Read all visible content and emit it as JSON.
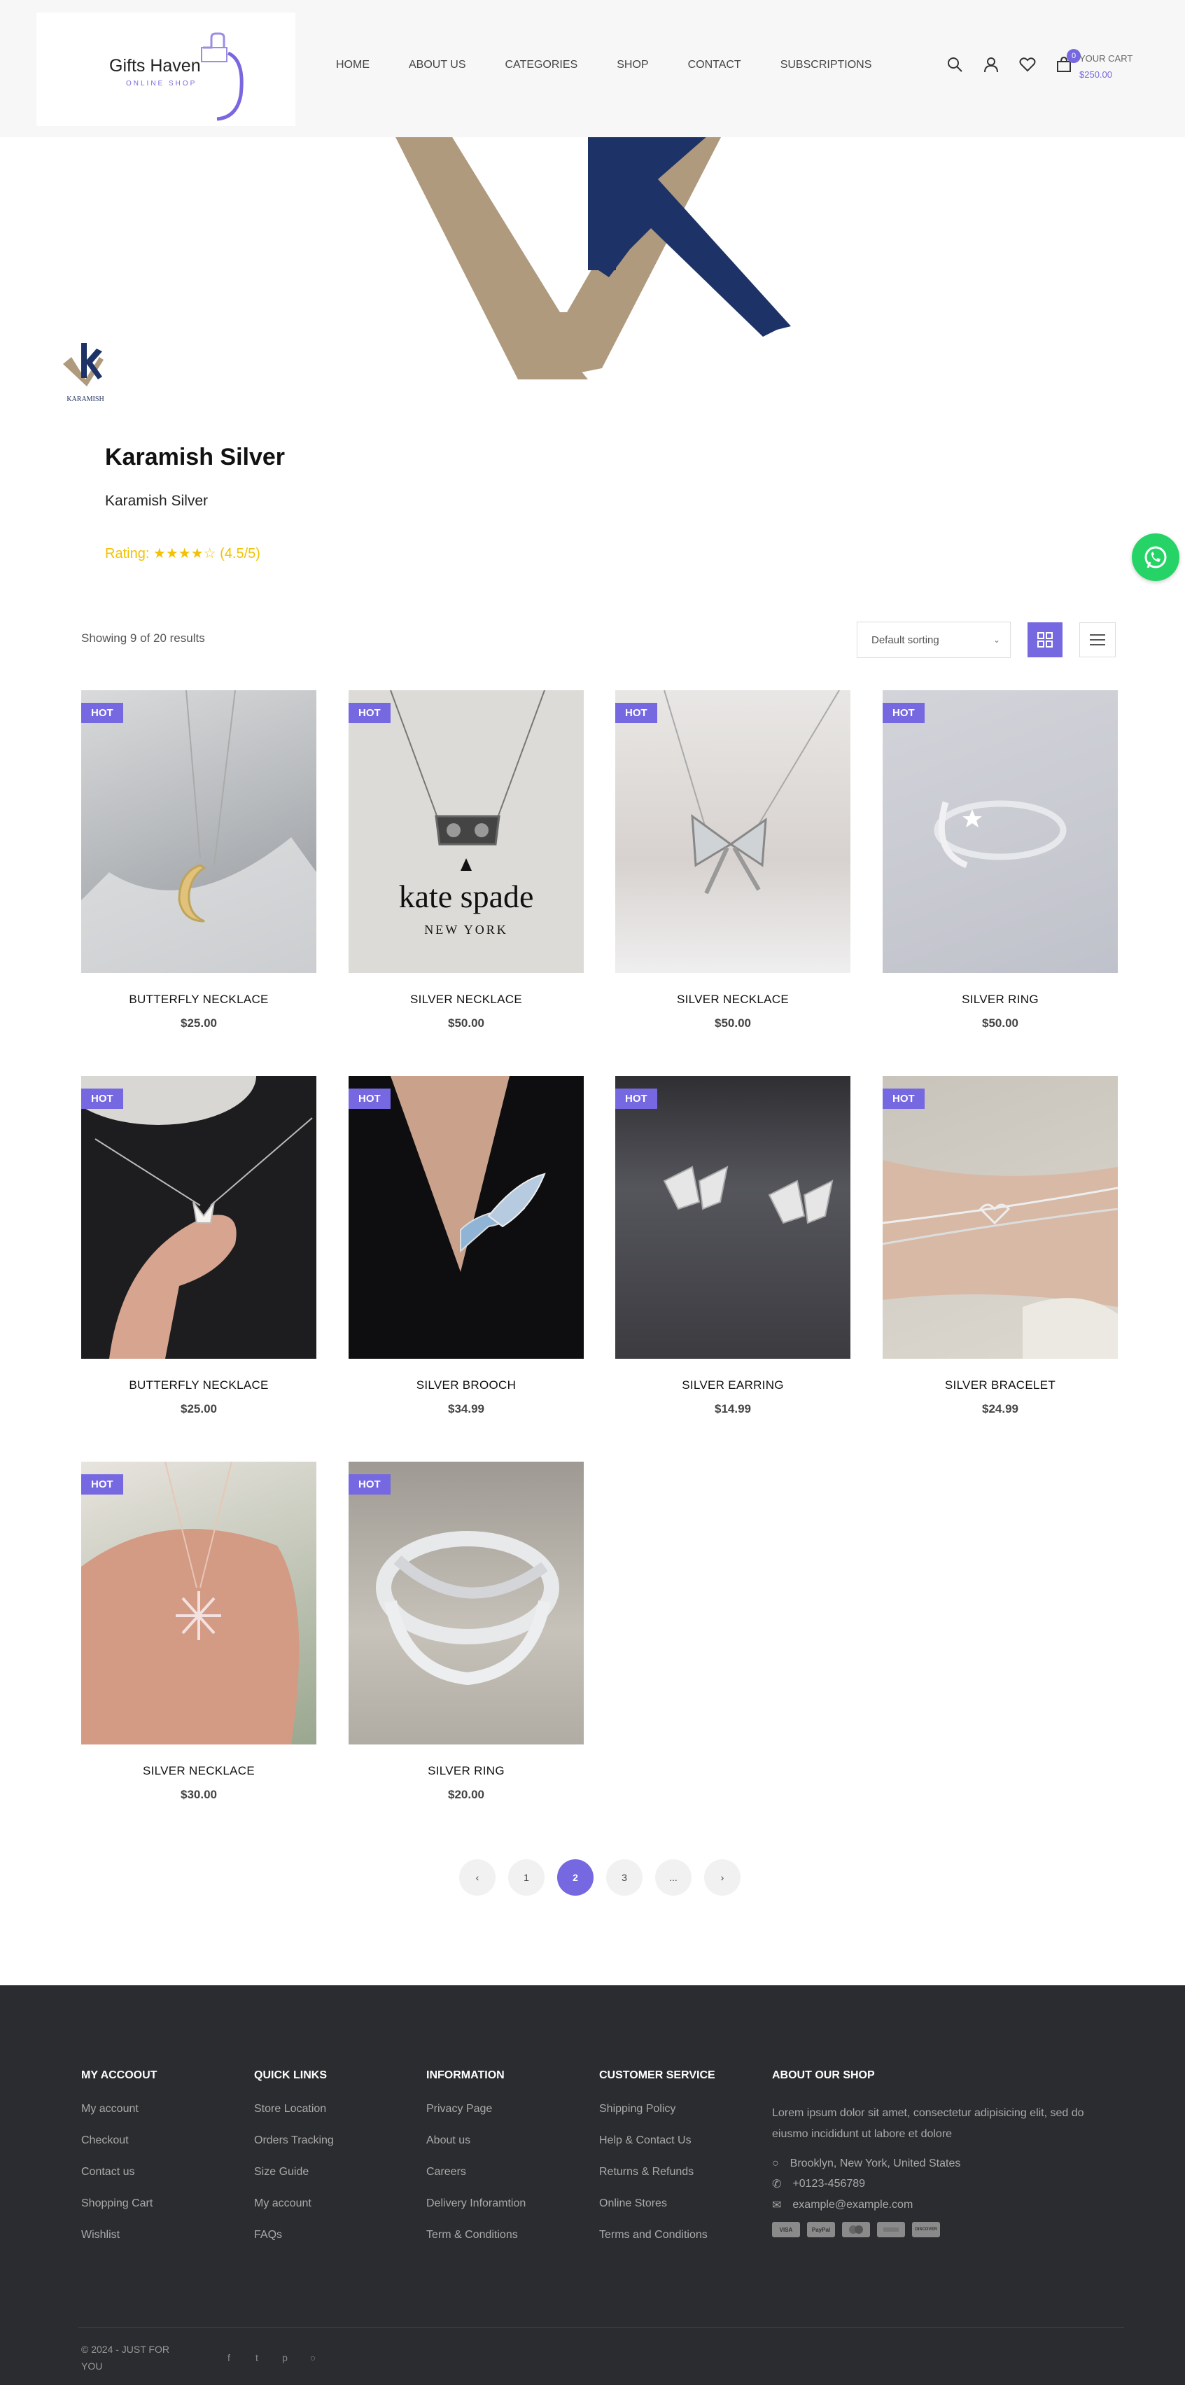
{
  "header": {
    "logo_title": "Gifts Haven",
    "logo_subtitle": "ONLINE SHOP",
    "nav": [
      "HOME",
      "ABOUT US",
      "CATEGORIES",
      "SHOP",
      "CONTACT",
      "SUBSCRIPTIONS"
    ],
    "cart_count": "0",
    "cart_label": "YOUR CART",
    "cart_total": "$250.00"
  },
  "brand": {
    "logo_text": "KARAMISH",
    "name": "Karamish Silver",
    "subtitle": "Karamish Silver",
    "rating": "Rating: ★★★★☆ (4.5/5)"
  },
  "toolbar": {
    "results": "Showing 9 of 20 results",
    "sort": "Default sorting"
  },
  "products": [
    {
      "badge": "HOT",
      "name": "BUTTERFLY NECKLACE",
      "price": "$25.00"
    },
    {
      "badge": "HOT",
      "name": "SILVER NECKLACE",
      "price": "$50.00",
      "image_text": "kate spade",
      "image_subtext": "NEW YORK"
    },
    {
      "badge": "HOT",
      "name": "SILVER NECKLACE",
      "price": "$50.00"
    },
    {
      "badge": "HOT",
      "name": "SILVER RING",
      "price": "$50.00"
    },
    {
      "badge": "HOT",
      "name": "BUTTERFLY NECKLACE",
      "price": "$25.00"
    },
    {
      "badge": "HOT",
      "name": "SILVER BROOCH",
      "price": "$34.99"
    },
    {
      "badge": "HOT",
      "name": "SILVER EARRING",
      "price": "$14.99"
    },
    {
      "badge": "HOT",
      "name": "SILVER BRACELET",
      "price": "$24.99"
    },
    {
      "badge": "HOT",
      "name": "SILVER NECKLACE",
      "price": "$30.00"
    },
    {
      "badge": "HOT",
      "name": "SILVER RING",
      "price": "$20.00"
    }
  ],
  "pagination": {
    "pages": [
      "1",
      "2",
      "3",
      "..."
    ],
    "active": "2"
  },
  "footer": {
    "account": {
      "title": "MY ACCOOUT",
      "links": [
        "My account",
        "Checkout",
        "Contact us",
        "Shopping Cart",
        "Wishlist"
      ]
    },
    "quick": {
      "title": "QUICK LINKS",
      "links": [
        "Store Location",
        "Orders Tracking",
        "Size Guide",
        "My account",
        "FAQs"
      ]
    },
    "info": {
      "title": "INFORMATION",
      "links": [
        "Privacy Page",
        "About us",
        "Careers",
        "Delivery Inforamtion",
        "Term & Conditions"
      ]
    },
    "service": {
      "title": "CUSTOMER SERVICE",
      "links": [
        "Shipping Policy",
        "Help & Contact Us",
        "Returns & Refunds",
        "Online Stores",
        "Terms and Conditions"
      ]
    },
    "about": {
      "title": "ABOUT OUR SHOP",
      "text": "Lorem ipsum dolor sit amet, consectetur adipisicing elit, sed do eiusmo incididunt ut labore et dolore",
      "address": "Brooklyn, New York, United States",
      "phone": "+0123-456789",
      "email": "example@example.com",
      "payments": [
        "VISA",
        "PayPal",
        "",
        "",
        "DISCOVER"
      ]
    },
    "copyright": "© 2024 - JUST FOR YOU"
  },
  "colors": {
    "accent": "#7568e0",
    "footer_bg": "#2b2c2f",
    "rating": "#f3c200",
    "whatsapp": "#25d366"
  }
}
